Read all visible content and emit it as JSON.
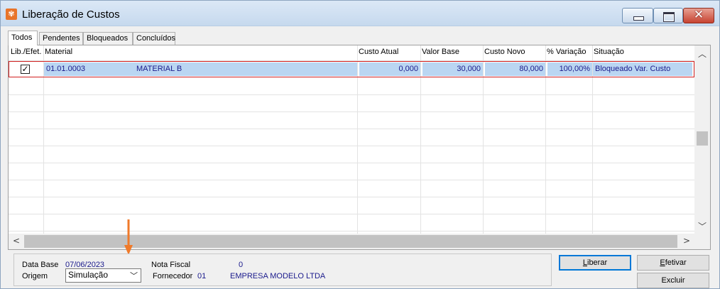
{
  "window": {
    "title": "Liberação de Custos",
    "app_icon": "app-icon",
    "controls": [
      "minimize-icon",
      "maximize-icon",
      "close-icon"
    ]
  },
  "tabs": [
    {
      "label": "Todos",
      "active": true
    },
    {
      "label": "Pendentes",
      "active": false
    },
    {
      "label": "Bloqueados",
      "active": false
    },
    {
      "label": "Concluídos",
      "active": false
    }
  ],
  "grid": {
    "columns": [
      "Lib./Efet.",
      "Material",
      "Custo Atual",
      "Valor Base",
      "Custo Novo",
      "% Variação",
      "Situação"
    ],
    "rows": [
      {
        "checked": true,
        "material_code": "01.01.0003",
        "material_name": "MATERIAL B",
        "custo_atual": "0,000",
        "valor_base": "30,000",
        "custo_novo": "80,000",
        "variacao": "100,00%",
        "situacao": "Bloqueado Var. Custo"
      }
    ]
  },
  "info": {
    "data_base_label": "Data Base",
    "data_base_value": "07/06/2023",
    "origem_label": "Origem",
    "origem_value": "Simulação",
    "nota_fiscal_label": "Nota Fiscal",
    "nota_fiscal_value": "0",
    "fornecedor_label": "Fornecedor",
    "fornecedor_code": "01",
    "fornecedor_name": "EMPRESA MODELO LTDA"
  },
  "buttons": {
    "liberar_prefix": "L",
    "liberar_rest": "iberar",
    "efetivar_prefix": "E",
    "efetivar_rest": "fetivar",
    "excluir": "Excluir"
  },
  "colors": {
    "selection": "#bad6f2",
    "value_text": "#1a1a8c",
    "row_border": "#d12020",
    "annotation_arrow": "#f07a2a"
  }
}
